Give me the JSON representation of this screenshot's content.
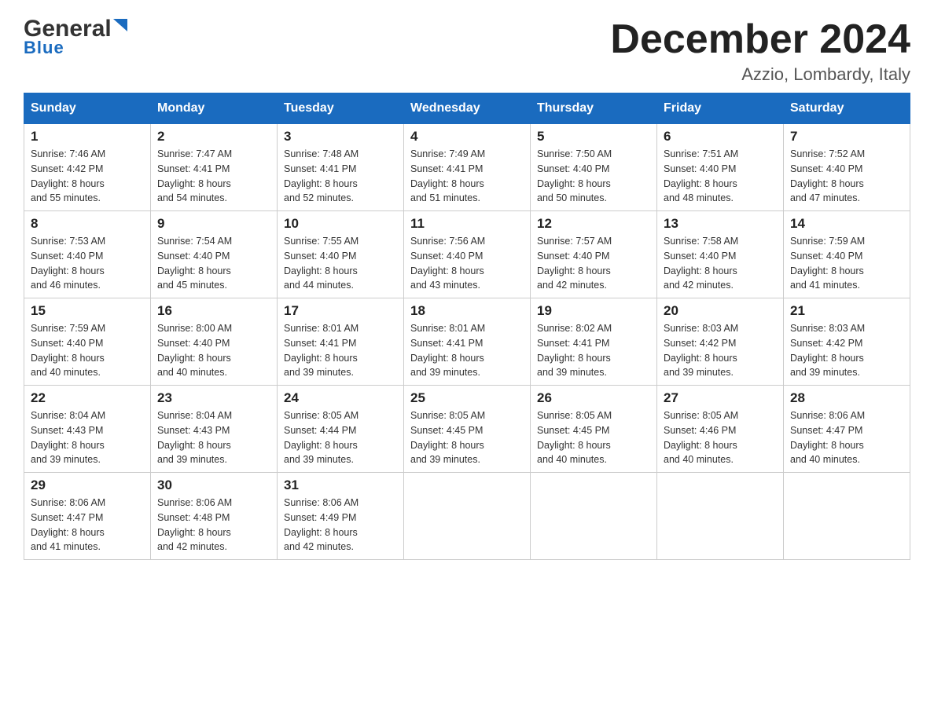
{
  "header": {
    "logo_general": "General",
    "logo_blue": "Blue",
    "month_title": "December 2024",
    "location": "Azzio, Lombardy, Italy"
  },
  "days_of_week": [
    "Sunday",
    "Monday",
    "Tuesday",
    "Wednesday",
    "Thursday",
    "Friday",
    "Saturday"
  ],
  "weeks": [
    [
      {
        "day": "1",
        "sunrise": "7:46 AM",
        "sunset": "4:42 PM",
        "daylight": "8 hours and 55 minutes."
      },
      {
        "day": "2",
        "sunrise": "7:47 AM",
        "sunset": "4:41 PM",
        "daylight": "8 hours and 54 minutes."
      },
      {
        "day": "3",
        "sunrise": "7:48 AM",
        "sunset": "4:41 PM",
        "daylight": "8 hours and 52 minutes."
      },
      {
        "day": "4",
        "sunrise": "7:49 AM",
        "sunset": "4:41 PM",
        "daylight": "8 hours and 51 minutes."
      },
      {
        "day": "5",
        "sunrise": "7:50 AM",
        "sunset": "4:40 PM",
        "daylight": "8 hours and 50 minutes."
      },
      {
        "day": "6",
        "sunrise": "7:51 AM",
        "sunset": "4:40 PM",
        "daylight": "8 hours and 48 minutes."
      },
      {
        "day": "7",
        "sunrise": "7:52 AM",
        "sunset": "4:40 PM",
        "daylight": "8 hours and 47 minutes."
      }
    ],
    [
      {
        "day": "8",
        "sunrise": "7:53 AM",
        "sunset": "4:40 PM",
        "daylight": "8 hours and 46 minutes."
      },
      {
        "day": "9",
        "sunrise": "7:54 AM",
        "sunset": "4:40 PM",
        "daylight": "8 hours and 45 minutes."
      },
      {
        "day": "10",
        "sunrise": "7:55 AM",
        "sunset": "4:40 PM",
        "daylight": "8 hours and 44 minutes."
      },
      {
        "day": "11",
        "sunrise": "7:56 AM",
        "sunset": "4:40 PM",
        "daylight": "8 hours and 43 minutes."
      },
      {
        "day": "12",
        "sunrise": "7:57 AM",
        "sunset": "4:40 PM",
        "daylight": "8 hours and 42 minutes."
      },
      {
        "day": "13",
        "sunrise": "7:58 AM",
        "sunset": "4:40 PM",
        "daylight": "8 hours and 42 minutes."
      },
      {
        "day": "14",
        "sunrise": "7:59 AM",
        "sunset": "4:40 PM",
        "daylight": "8 hours and 41 minutes."
      }
    ],
    [
      {
        "day": "15",
        "sunrise": "7:59 AM",
        "sunset": "4:40 PM",
        "daylight": "8 hours and 40 minutes."
      },
      {
        "day": "16",
        "sunrise": "8:00 AM",
        "sunset": "4:40 PM",
        "daylight": "8 hours and 40 minutes."
      },
      {
        "day": "17",
        "sunrise": "8:01 AM",
        "sunset": "4:41 PM",
        "daylight": "8 hours and 39 minutes."
      },
      {
        "day": "18",
        "sunrise": "8:01 AM",
        "sunset": "4:41 PM",
        "daylight": "8 hours and 39 minutes."
      },
      {
        "day": "19",
        "sunrise": "8:02 AM",
        "sunset": "4:41 PM",
        "daylight": "8 hours and 39 minutes."
      },
      {
        "day": "20",
        "sunrise": "8:03 AM",
        "sunset": "4:42 PM",
        "daylight": "8 hours and 39 minutes."
      },
      {
        "day": "21",
        "sunrise": "8:03 AM",
        "sunset": "4:42 PM",
        "daylight": "8 hours and 39 minutes."
      }
    ],
    [
      {
        "day": "22",
        "sunrise": "8:04 AM",
        "sunset": "4:43 PM",
        "daylight": "8 hours and 39 minutes."
      },
      {
        "day": "23",
        "sunrise": "8:04 AM",
        "sunset": "4:43 PM",
        "daylight": "8 hours and 39 minutes."
      },
      {
        "day": "24",
        "sunrise": "8:05 AM",
        "sunset": "4:44 PM",
        "daylight": "8 hours and 39 minutes."
      },
      {
        "day": "25",
        "sunrise": "8:05 AM",
        "sunset": "4:45 PM",
        "daylight": "8 hours and 39 minutes."
      },
      {
        "day": "26",
        "sunrise": "8:05 AM",
        "sunset": "4:45 PM",
        "daylight": "8 hours and 40 minutes."
      },
      {
        "day": "27",
        "sunrise": "8:05 AM",
        "sunset": "4:46 PM",
        "daylight": "8 hours and 40 minutes."
      },
      {
        "day": "28",
        "sunrise": "8:06 AM",
        "sunset": "4:47 PM",
        "daylight": "8 hours and 40 minutes."
      }
    ],
    [
      {
        "day": "29",
        "sunrise": "8:06 AM",
        "sunset": "4:47 PM",
        "daylight": "8 hours and 41 minutes."
      },
      {
        "day": "30",
        "sunrise": "8:06 AM",
        "sunset": "4:48 PM",
        "daylight": "8 hours and 42 minutes."
      },
      {
        "day": "31",
        "sunrise": "8:06 AM",
        "sunset": "4:49 PM",
        "daylight": "8 hours and 42 minutes."
      },
      null,
      null,
      null,
      null
    ]
  ],
  "labels": {
    "sunrise": "Sunrise:",
    "sunset": "Sunset:",
    "daylight": "Daylight:"
  }
}
